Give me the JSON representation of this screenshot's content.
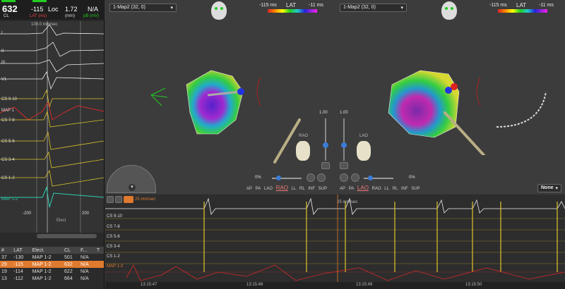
{
  "header": {
    "cl_value": "632",
    "cl_label": "CL",
    "lat_value": "-115",
    "lat_label": "LAT (ms)",
    "loc_label": "Loc",
    "loc_value": "1.72",
    "loc_unit": "(mm)",
    "bipolar_value": "N/A",
    "bipolar_label": "pB (mV)"
  },
  "egm": {
    "scale_top": "100.0 mm/sec",
    "channels": [
      "I",
      "II",
      "III",
      "V1",
      "CS 9-10",
      "MAP 1",
      "CS 7-8",
      "CS 5-6",
      "CS 3-4",
      "CS 1-2",
      "MAP 1-2"
    ],
    "axis_left": "-200",
    "axis_right": "200",
    "bottom_label": "Elect"
  },
  "table": {
    "headers": [
      "#",
      "LAT",
      "Elect.",
      "CL",
      "F...",
      "T"
    ],
    "rows": [
      [
        "37",
        "-130",
        "MAP 1-2",
        "501",
        "N/A",
        ""
      ],
      [
        "29",
        "-115",
        "MAP 1-2",
        "632",
        "N/A",
        ""
      ],
      [
        "19",
        "-114",
        "MAP 1-2",
        "622",
        "N/A",
        ""
      ],
      [
        "13",
        "-112",
        "MAP 1-2",
        "664",
        "N/A",
        ""
      ]
    ],
    "selected_row": 1
  },
  "pane_a": {
    "map_select": "1-Map2 (32, 0)",
    "lat_min": "-115 ms",
    "lat_title": "LAT",
    "lat_max": "-11 ms",
    "view": "RAO",
    "views": [
      "AP",
      "PA",
      "LAO",
      "RAO",
      "LL",
      "RL",
      "INF",
      "SUP"
    ],
    "zoom_value": "1.00",
    "percent": "0%"
  },
  "pane_b": {
    "map_select": "1-Map2 (32, 0)",
    "lat_min": "-115 ms",
    "lat_title": "LAT",
    "lat_max": "-11 ms",
    "view": "LAO",
    "views": [
      "AP",
      "PA",
      "LAO",
      "RAO",
      "LL",
      "RL",
      "INF",
      "SUP"
    ],
    "zoom_value": "1.00",
    "percent": "0%",
    "dropdown": "None"
  },
  "strip": {
    "speed": "25 mm/sec",
    "channels": [
      "CS 9-10",
      "CS 7-8",
      "CS 5-6",
      "CS 3-4",
      "CS 1-2",
      "MAP 1-2"
    ],
    "times": [
      "13:15:47",
      "13:15:48",
      "13:15:49",
      "13:15:50"
    ]
  },
  "colors": {
    "accent": "#e07a2e",
    "cs_trace": "#d9c32b",
    "map_trace": "#d42a2a",
    "ecg_trace": "#f0f0f0"
  }
}
